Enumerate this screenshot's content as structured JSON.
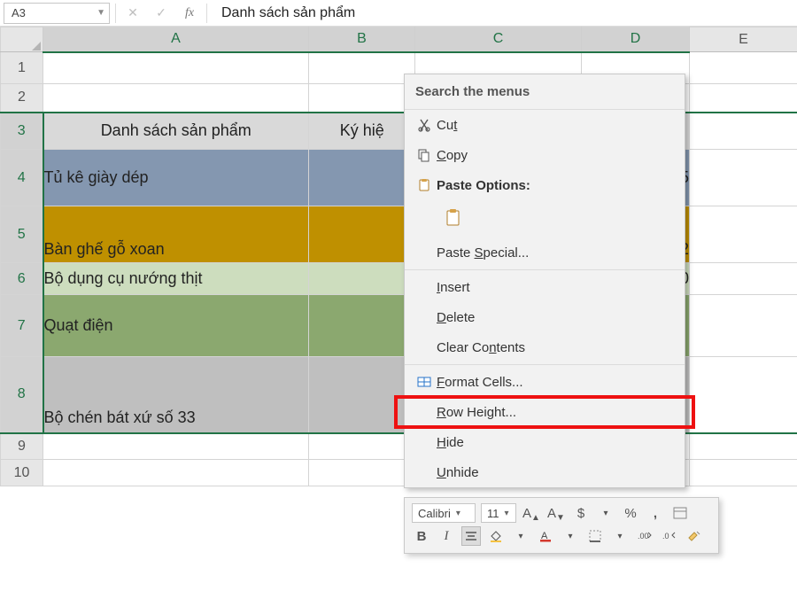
{
  "namebox": {
    "ref": "A3"
  },
  "formula_bar": {
    "value": "Danh sách sản phẩm"
  },
  "columns": [
    "A",
    "B",
    "C",
    "D",
    "E"
  ],
  "row_numbers": [
    "1",
    "2",
    "3",
    "4",
    "5",
    "6",
    "7",
    "8",
    "9",
    "10"
  ],
  "table": {
    "header": {
      "a": "Danh sách sản phẩm",
      "b": "Ký hiệ"
    },
    "rows": [
      {
        "a": "Tủ kê giày dép",
        "d_tail": "5"
      },
      {
        "a": "Bàn ghế gỗ xoan",
        "d_tail": "2"
      },
      {
        "a": "Bộ dụng cụ nướng thịt",
        "d_tail": "0"
      },
      {
        "a": "Quạt điện",
        "d_tail": ""
      },
      {
        "a": "Bộ chén bát xứ số 33",
        "d_tail": ""
      }
    ]
  },
  "context_menu": {
    "search": "Search the menus",
    "cut": {
      "pre": "Cu",
      "u": "t",
      "post": ""
    },
    "copy": {
      "pre": "",
      "u": "C",
      "post": "opy"
    },
    "paste_options": "Paste Options:",
    "paste_special": {
      "pre": "Paste ",
      "u": "S",
      "post": "pecial..."
    },
    "insert": {
      "pre": "",
      "u": "I",
      "post": "nsert"
    },
    "delete": {
      "pre": "",
      "u": "D",
      "post": "elete"
    },
    "clear": {
      "pre": "Clear Co",
      "u": "n",
      "post": "tents"
    },
    "format_cells": {
      "pre": "",
      "u": "F",
      "post": "ormat Cells..."
    },
    "row_height": {
      "pre": "",
      "u": "R",
      "post": "ow Height..."
    },
    "hide": {
      "pre": "",
      "u": "H",
      "post": "ide"
    },
    "unhide": {
      "pre": "",
      "u": "U",
      "post": "nhide"
    }
  },
  "mini_toolbar": {
    "font": "Calibri",
    "size": "11",
    "currency": "$",
    "percent": "%",
    "comma": ","
  }
}
